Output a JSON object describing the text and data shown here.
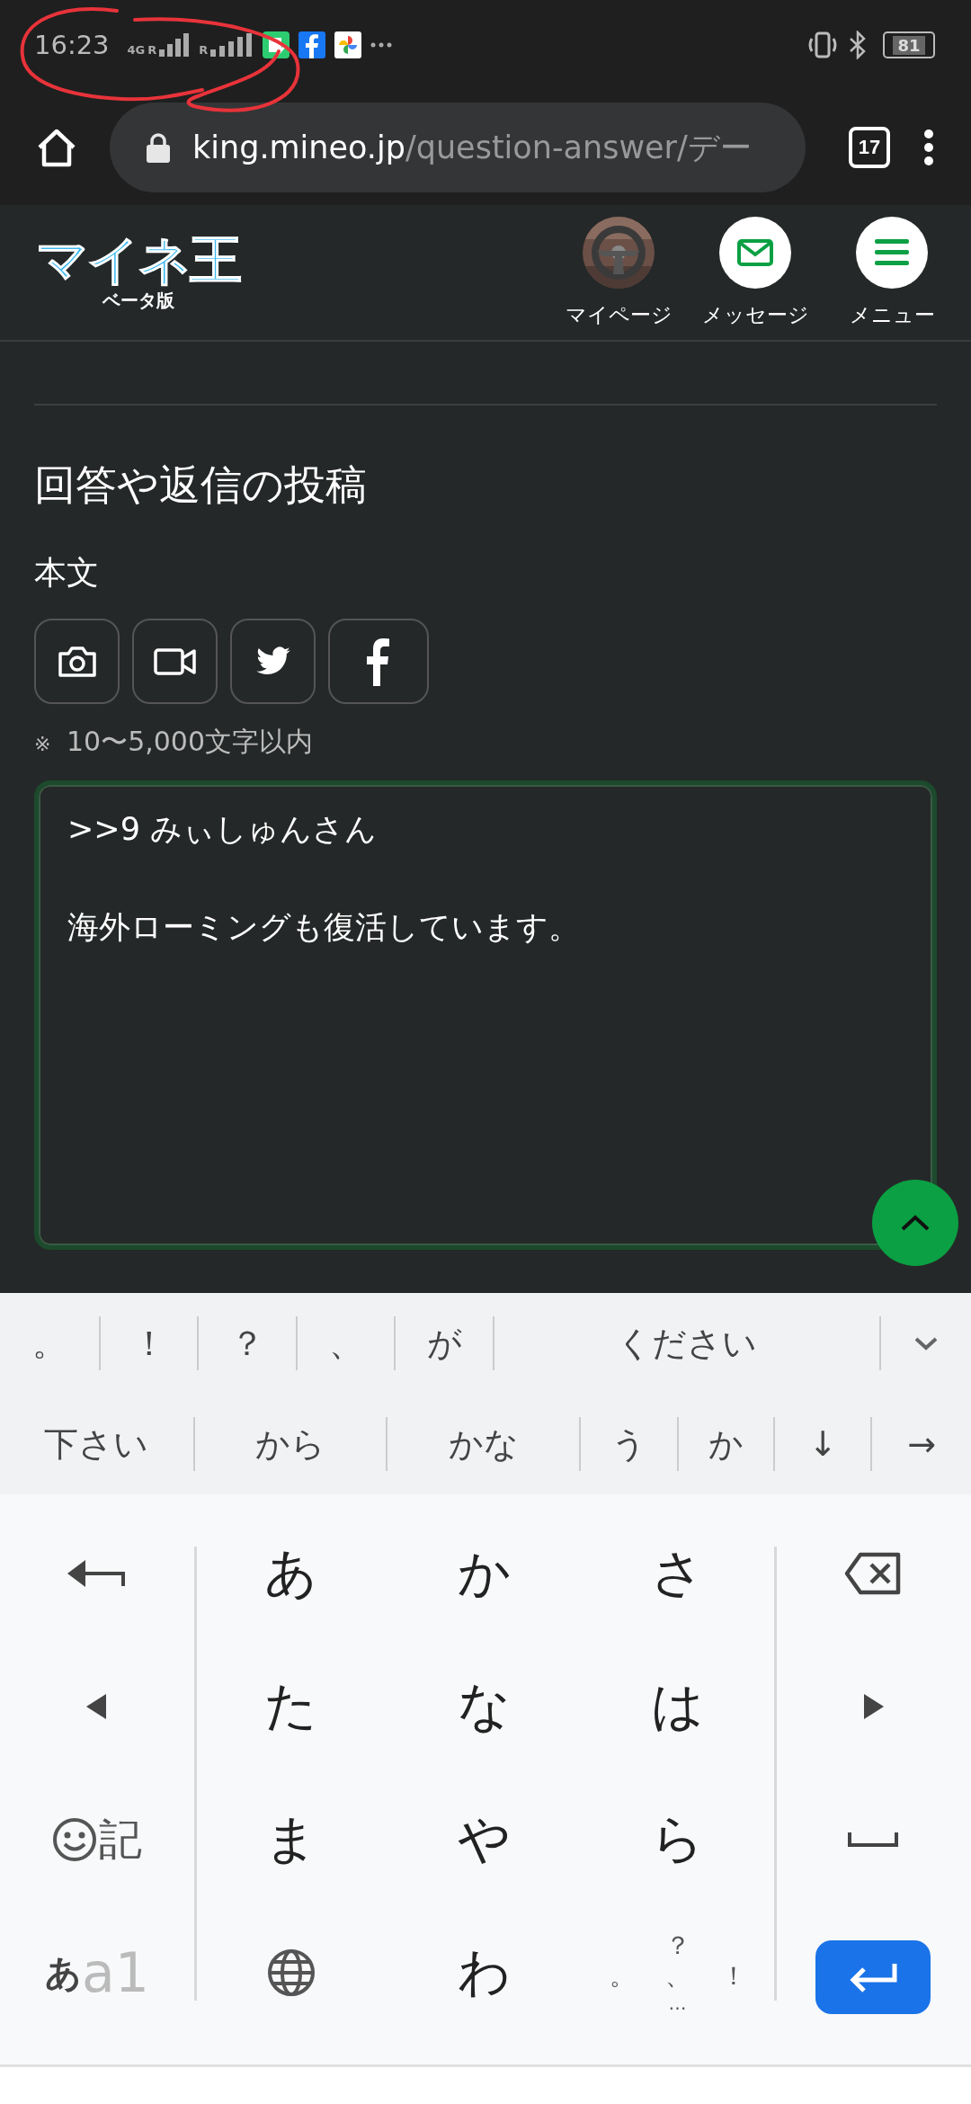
{
  "status_bar": {
    "time": "16:23",
    "network": "4G",
    "roaming_1": "R",
    "roaming_2": "R",
    "battery": "81"
  },
  "browser": {
    "url_host": "king.mineo.jp",
    "url_path": "/question-answer/デー",
    "tab_count": "17"
  },
  "header": {
    "logo": "マイネ王",
    "logo_sub": "ベータ版",
    "nav": [
      {
        "kind": "avatar",
        "label": "マイページ"
      },
      {
        "kind": "mail",
        "label": "メッセージ"
      },
      {
        "kind": "menu",
        "label": "メニュー"
      }
    ]
  },
  "form": {
    "title": "回答や返信の投稿",
    "label": "本文",
    "tools": [
      {
        "kind": "camera"
      },
      {
        "kind": "video"
      },
      {
        "kind": "twitter"
      },
      {
        "kind": "facebook"
      }
    ],
    "note_mark": "※",
    "note": "10〜5,000文字以内",
    "lines": [
      ">>9 みぃしゅんさん",
      "海外ローミングも復活しています。"
    ]
  },
  "suggestions": [
    [
      "。",
      "！",
      "？",
      "、",
      "が",
      "ください"
    ],
    [
      "下さい",
      "から",
      "かな",
      "う",
      "か",
      "↓",
      "→"
    ]
  ],
  "keys": [
    {
      "kind": "undo"
    },
    {
      "kind": "char",
      "label": "あ"
    },
    {
      "kind": "char",
      "label": "か"
    },
    {
      "kind": "char",
      "label": "さ"
    },
    {
      "kind": "backspace"
    },
    {
      "kind": "left"
    },
    {
      "kind": "char",
      "label": "た"
    },
    {
      "kind": "char",
      "label": "な"
    },
    {
      "kind": "char",
      "label": "は"
    },
    {
      "kind": "right"
    },
    {
      "kind": "emoji",
      "label": "記"
    },
    {
      "kind": "char",
      "label": "ま"
    },
    {
      "kind": "char",
      "label": "や"
    },
    {
      "kind": "char",
      "label": "ら"
    },
    {
      "kind": "space"
    },
    {
      "kind": "mode",
      "label": "あ",
      "label_2": "a1"
    },
    {
      "kind": "globe"
    },
    {
      "kind": "char",
      "label": "わ"
    },
    {
      "kind": "punct",
      "marks": [
        "？",
        "。",
        "、",
        "！",
        "…"
      ]
    },
    {
      "kind": "enter"
    }
  ]
}
